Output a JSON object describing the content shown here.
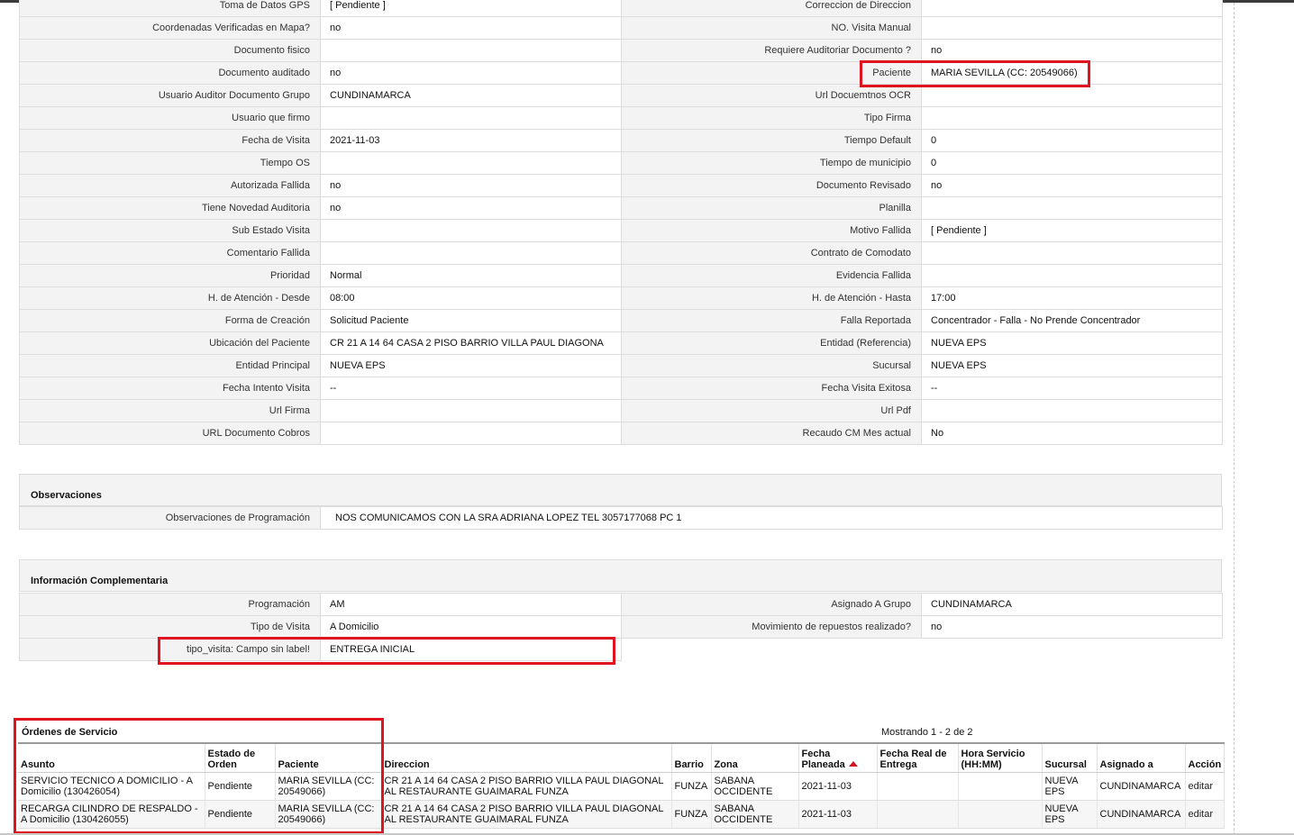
{
  "details": {
    "rows": [
      {
        "l1": "Toma de Datos GPS",
        "v1": "[ Pendiente ]",
        "l2": "Correccion de Direccion",
        "v2": ""
      },
      {
        "l1": "Coordenadas Verificadas en Mapa?",
        "v1": "no",
        "l2": "NO. Visita Manual",
        "v2": ""
      },
      {
        "l1": "Documento fisico",
        "v1": "",
        "l2": "Requiere Auditoriar Documento ?",
        "v2": "no"
      },
      {
        "l1": "Documento auditado",
        "v1": "no",
        "l2": "Paciente",
        "v2": "MARIA SEVILLA (CC: 20549066)"
      },
      {
        "l1": "Usuario Auditor Documento Grupo",
        "v1": "CUNDINAMARCA",
        "l2": "Url Docuemtnos OCR",
        "v2": ""
      },
      {
        "l1": "Usuario que firmo",
        "v1": "",
        "l2": "Tipo Firma",
        "v2": ""
      },
      {
        "l1": "Fecha de Visita",
        "v1": "2021-11-03",
        "l2": "Tiempo Default",
        "v2": "0"
      },
      {
        "l1": "Tiempo OS",
        "v1": "",
        "l2": "Tiempo de municipio",
        "v2": "0"
      },
      {
        "l1": "Autorizada Fallida",
        "v1": "no",
        "l2": "Documento Revisado",
        "v2": "no"
      },
      {
        "l1": "Tiene Novedad Auditoria",
        "v1": "no",
        "l2": "Planilla",
        "v2": ""
      },
      {
        "l1": "Sub Estado Visita",
        "v1": "",
        "l2": "Motivo Fallida",
        "v2": "[ Pendiente ]"
      },
      {
        "l1": "Comentario Fallida",
        "v1": "",
        "l2": "Contrato de Comodato",
        "v2": ""
      },
      {
        "l1": "Prioridad",
        "v1": "Normal",
        "l2": "Evidencia Fallida",
        "v2": ""
      },
      {
        "l1": "H. de Atención - Desde",
        "v1": "08:00",
        "l2": "H. de Atención - Hasta",
        "v2": "17:00"
      },
      {
        "l1": "Forma de Creación",
        "v1": "Solicitud Paciente",
        "l2": "Falla Reportada",
        "v2": "Concentrador - Falla - No Prende Concentrador"
      },
      {
        "l1": "Ubicación del Paciente",
        "v1": "CR 21 A 14 64 CASA 2 PISO BARRIO VILLA PAUL DIAGONA",
        "l2": "Entidad (Referencia)",
        "v2": "NUEVA EPS"
      },
      {
        "l1": "Entidad Principal",
        "v1": "NUEVA EPS",
        "l2": "Sucursal",
        "v2": "NUEVA EPS"
      },
      {
        "l1": "Fecha Intento Visita",
        "v1": "--",
        "l2": "Fecha Visita Exitosa",
        "v2": "--"
      },
      {
        "l1": "Url Firma",
        "v1": "",
        "l2": "Url Pdf",
        "v2": ""
      },
      {
        "l1": "URL Documento Cobros",
        "v1": "",
        "l2": "Recaudo CM Mes actual",
        "v2": "No"
      }
    ]
  },
  "observaciones": {
    "title": "Observaciones",
    "label": "Observaciones de Programación",
    "value": "NOS COMUNICAMOS CON LA SRA ADRIANA LOPEZ TEL 3057177068 PC 1"
  },
  "complementaria": {
    "title": "Información Complementaria",
    "rows": [
      {
        "l1": "Programación",
        "v1": "AM",
        "l2": "Asignado A Grupo",
        "v2": "CUNDINAMARCA"
      },
      {
        "l1": "Tipo de Visita",
        "v1": "A Domicilio",
        "l2": "Movimiento de repuestos realizado?",
        "v2": "no"
      },
      {
        "l1": "tipo_visita: Campo sin label!",
        "v1": "ENTREGA INICIAL"
      }
    ]
  },
  "orders": {
    "title": "Órdenes de Servicio",
    "count_text": "Mostrando 1 - 2 de 2",
    "columns": [
      "Asunto",
      "Estado de Orden",
      "Paciente",
      "Direccion",
      "Barrio",
      "Zona",
      "Fecha Planeada",
      "Fecha Real de Entrega",
      "Hora Servicio (HH:MM)",
      "Sucursal",
      "Asignado a",
      "Acción"
    ],
    "rows": [
      {
        "asunto": "SERVICIO TECNICO A DOMICILIO - A Domicilio (130426054)",
        "estado": "Pendiente",
        "paciente": "MARIA SEVILLA (CC: 20549066)",
        "direccion": "CR 21 A 14 64 CASA 2 PISO BARRIO VILLA PAUL DIAGONAL AL RESTAURANTE GUAIMARAL FUNZA",
        "barrio": "FUNZA",
        "zona": "SABANA OCCIDENTE",
        "fecha_planeada": "2021-11-03",
        "fecha_real": "",
        "hora": "",
        "sucursal": "NUEVA EPS",
        "asignado": "CUNDINAMARCA",
        "accion": "editar"
      },
      {
        "asunto": "RECARGA CILINDRO DE RESPALDO - A Domicilio (130426055)",
        "estado": "Pendiente",
        "paciente": "MARIA SEVILLA (CC: 20549066)",
        "direccion": "CR 21 A 14 64 CASA 2 PISO BARRIO VILLA PAUL DIAGONAL AL RESTAURANTE GUAIMARAL FUNZA",
        "barrio": "FUNZA",
        "zona": "SABANA OCCIDENTE",
        "fecha_planeada": "2021-11-03",
        "fecha_real": "",
        "hora": "",
        "sucursal": "NUEVA EPS",
        "asignado": "CUNDINAMARCA",
        "accion": "editar"
      }
    ]
  },
  "colors": {
    "highlight": "#e0141e",
    "sort_arrow": "#d0151c"
  }
}
